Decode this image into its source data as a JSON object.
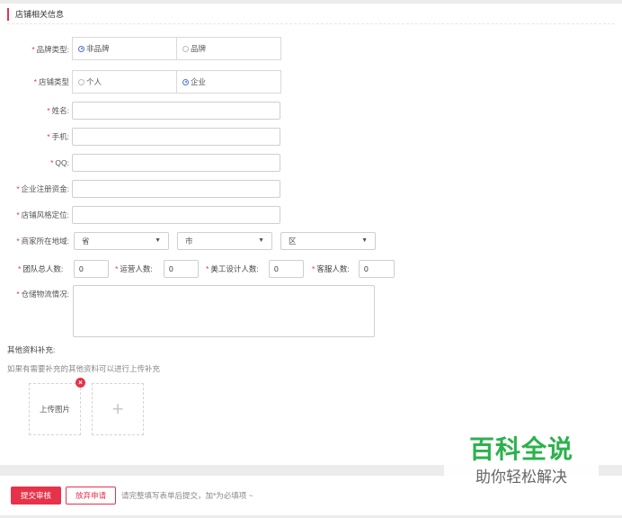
{
  "section": {
    "title": "店铺相关信息"
  },
  "form": {
    "brand_type": {
      "label": "品牌类型:",
      "options": [
        "非品牌",
        "品牌"
      ],
      "selected": "非品牌"
    },
    "shop_type": {
      "label": "店铺类型",
      "options": [
        "个人",
        "企业"
      ],
      "selected": "企业"
    },
    "name": {
      "label": "姓名:",
      "value": ""
    },
    "phone": {
      "label": "手机:",
      "value": ""
    },
    "qq": {
      "label": "QQ:",
      "value": ""
    },
    "capital": {
      "label": "企业注册资金:",
      "value": ""
    },
    "style": {
      "label": "店铺风格定位:",
      "value": ""
    },
    "location": {
      "label": "商家所在地域:",
      "province": "省",
      "city": "市",
      "district": "区"
    },
    "staff": {
      "team_label": "团队总人数:",
      "team_value": "0",
      "ops_label": "运营人数:",
      "ops_value": "0",
      "design_label": "美工设计人数:",
      "design_value": "0",
      "service_label": "客服人数:",
      "service_value": "0"
    },
    "logistics": {
      "label": "仓储物流情况:",
      "value": ""
    }
  },
  "extra": {
    "title": "其他资料补充:",
    "desc": "如果有需要补充的其他资料可以进行上传补充",
    "upload_label": "上传图片",
    "remove_glyph": "×",
    "add_glyph": "+"
  },
  "footer": {
    "submit_label": "提交审核",
    "cancel_label": "放弃申请",
    "hint": "请完整填写表单后提交，加*为必填项 ~"
  },
  "watermark": {
    "title": "百科全说",
    "subtitle": "助你轻松解决"
  },
  "colors": {
    "accent": "#e6334a",
    "radio": "#4a74c9",
    "watermark": "#2bb24c"
  }
}
